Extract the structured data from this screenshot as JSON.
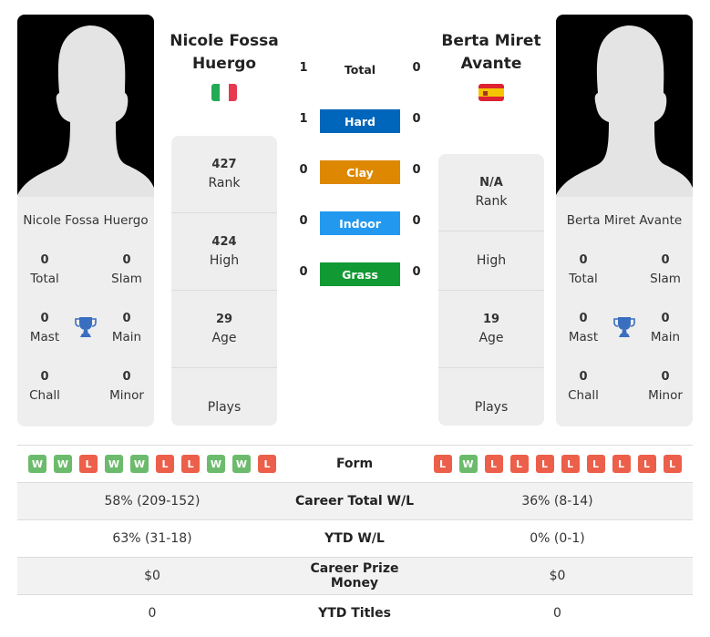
{
  "player1": {
    "name": "Nicole Fossa Huergo",
    "name_line1": "Nicole Fossa",
    "name_line2": "Huergo",
    "country_flag": "italy-flag",
    "titles": {
      "total": "0",
      "total_label": "Total",
      "slam": "0",
      "slam_label": "Slam",
      "mast": "0",
      "mast_label": "Mast",
      "main": "0",
      "main_label": "Main",
      "chall": "0",
      "chall_label": "Chall",
      "minor": "0",
      "minor_label": "Minor"
    },
    "stats": {
      "rank": "427",
      "rank_label": "Rank",
      "high": "424",
      "high_label": "High",
      "age": "29",
      "age_label": "Age",
      "plays": "",
      "plays_label": "Plays"
    },
    "form": [
      "W",
      "W",
      "L",
      "W",
      "W",
      "L",
      "L",
      "W",
      "W",
      "L"
    ],
    "career_wl": "58% (209-152)",
    "ytd_wl": "63% (31-18)",
    "prize": "$0",
    "ytd_titles": "0"
  },
  "player2": {
    "name": "Berta Miret Avante",
    "name_line1": "Berta Miret",
    "name_line2": "Avante",
    "country_flag": "spain-flag",
    "titles": {
      "total": "0",
      "total_label": "Total",
      "slam": "0",
      "slam_label": "Slam",
      "mast": "0",
      "mast_label": "Mast",
      "main": "0",
      "main_label": "Main",
      "chall": "0",
      "chall_label": "Chall",
      "minor": "0",
      "minor_label": "Minor"
    },
    "stats": {
      "rank": "N/A",
      "rank_label": "Rank",
      "high": "",
      "high_label": "High",
      "age": "19",
      "age_label": "Age",
      "plays": "",
      "plays_label": "Plays"
    },
    "form": [
      "L",
      "W",
      "L",
      "L",
      "L",
      "L",
      "L",
      "L",
      "L",
      "L"
    ],
    "career_wl": "36% (8-14)",
    "ytd_wl": "0% (0-1)",
    "prize": "$0",
    "ytd_titles": "0"
  },
  "h2h": {
    "total": {
      "label": "Total",
      "p1": "1",
      "p2": "0"
    },
    "surfaces": [
      {
        "label": "Hard",
        "p1": "1",
        "p2": "0",
        "color": "#0066bb"
      },
      {
        "label": "Clay",
        "p1": "0",
        "p2": "0",
        "color": "#dd8800"
      },
      {
        "label": "Indoor",
        "p1": "0",
        "p2": "0",
        "color": "#2299ee"
      },
      {
        "label": "Grass",
        "p1": "0",
        "p2": "0",
        "color": "#119933"
      }
    ]
  },
  "table_labels": {
    "form": "Form",
    "career_wl": "Career Total W/L",
    "ytd_wl": "YTD W/L",
    "prize": "Career Prize Money",
    "ytd_titles": "YTD Titles"
  }
}
